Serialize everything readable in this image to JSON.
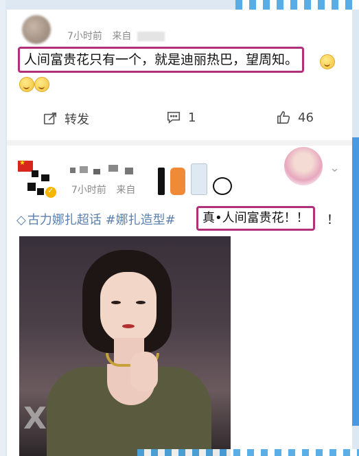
{
  "post1": {
    "time": "7小时前",
    "from_label": "来自",
    "highlight_text": "人间富贵花只有一个，就是迪丽热巴，望周知。",
    "repost_label": "转发",
    "comment_count": "1",
    "like_count": "46"
  },
  "post2": {
    "time": "7小时前",
    "from_label": "来自",
    "topic_text": "古力娜扎超话 #娜扎造型#",
    "highlight_text": "真•人间富贵花！！",
    "trailing_exclaim": "！"
  },
  "colors": {
    "highlight_border": "#b0317a",
    "topic_blue": "#5b7fae",
    "verify_badge": "#f7b500"
  },
  "icons": [
    "repost-icon",
    "comment-icon",
    "like-icon",
    "chevron-down-icon",
    "verified-badge-icon",
    "diamond-topic-icon",
    "smile-emoji-icon"
  ]
}
